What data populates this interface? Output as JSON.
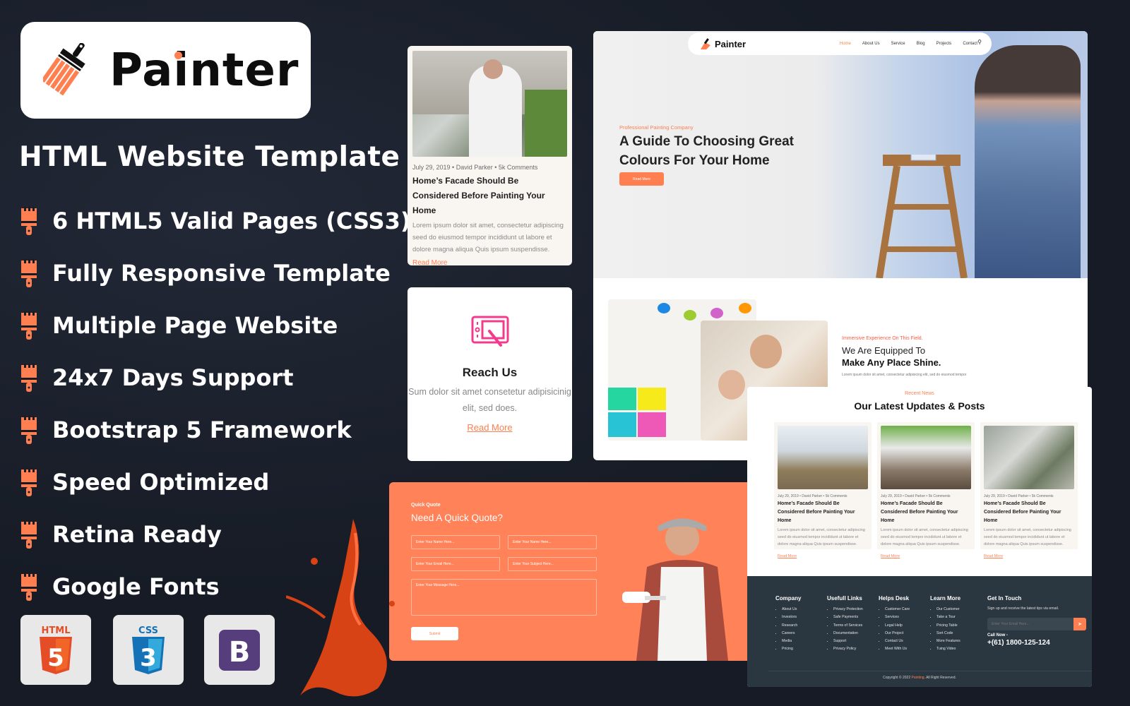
{
  "brand": {
    "name": "Painter",
    "accent": "#ff7f50"
  },
  "subtitle": "HTML Website Template",
  "features": [
    {
      "icon": "paint-brush-icon",
      "label": "6 HTML5 Valid Pages (CSS3)"
    },
    {
      "icon": "paint-brush-icon",
      "label": "Fully Responsive Template"
    },
    {
      "icon": "paint-brush-icon",
      "label": "Multiple Page Website"
    },
    {
      "icon": "paint-brush-icon",
      "label": "24x7 Days Support"
    },
    {
      "icon": "paint-brush-icon",
      "label": "Bootstrap 5 Framework"
    },
    {
      "icon": "paint-brush-icon",
      "label": "Speed Optimized"
    },
    {
      "icon": "paint-brush-icon",
      "label": "Retina Ready"
    },
    {
      "icon": "paint-brush-icon",
      "label": "Google Fonts"
    }
  ],
  "tech_badges": [
    {
      "icon": "html5-icon",
      "label": "HTML",
      "num": "5",
      "color": "#e44d26"
    },
    {
      "icon": "css3-icon",
      "label": "CSS",
      "num": "3",
      "color": "#1572b6"
    },
    {
      "icon": "bootstrap-icon",
      "label": "B",
      "color": "#563d7c"
    }
  ],
  "blog_card": {
    "meta": "July 29, 2019  •  David Parker  •  5k Comments",
    "title": "Home’s Facade Should Be Considered Before Painting Your Home",
    "excerpt": "Lorem ipsum dolor sit amet, consectetur adipiscing seed do eiusmod tempor incididunt ut labore et dolore magna aliqua Quis ipsum suspendisse.",
    "read_more": "Read More"
  },
  "reach_card": {
    "icon": "drawing-tablet-icon",
    "title": "Reach Us",
    "text": "Sum dolor sit amet consetetur adipisicinig elit, sed does.",
    "read_more": "Read More"
  },
  "site": {
    "nav": {
      "logo": "Painter",
      "links": [
        "Home",
        "About Us",
        "Service",
        "Blog",
        "Projects",
        "Contact"
      ],
      "active": "Home",
      "search_icon": "search-icon"
    },
    "hero": {
      "tag": "Professional Painting Company",
      "title_line1": "A Guide To Choosing Great",
      "title_line2": "Colours For Your Home",
      "button": "Read More"
    },
    "about": {
      "tag": "Immersive Experience On This Field.",
      "title_line1": "We Are Equipped To",
      "title_line2": "Make Any Place Shine.",
      "text": "Lorem ipsum dolor sit amet, consectetur adipisicing elit, sed do eiusmod tempor"
    }
  },
  "news": {
    "tag": "Recent News",
    "title": "Our Latest Updates & Posts",
    "posts": [
      {
        "meta": "July 29, 2019  •  David Parker  •  5k Comments",
        "title": "Home’s Facade Should Be Considered Before Painting Your Home",
        "excerpt": "Lorem ipsum dolor sit amet, consectetur adipiscing seed do eiusmod tempor incididunt ut labore et dolore magna aliqua Quis ipsum suspendisse.",
        "read_more": "Read More"
      },
      {
        "meta": "July 29, 2019  •  David Parker  •  5k Comments",
        "title": "Home’s Facade Should Be Considered Before Painting Your Home",
        "excerpt": "Lorem ipsum dolor sit amet, consectetur adipiscing seed do eiusmod tempor incididunt ut labore et dolore magna aliqua Quis ipsum suspendisse.",
        "read_more": "Read More"
      },
      {
        "meta": "July 29, 2019  •  David Parker  •  5k Comments",
        "title": "Home’s Facade Should Be Considered Before Painting Your Home",
        "excerpt": "Lorem ipsum dolor sit amet, consectetur adipiscing seed do eiusmod tempor incididunt ut labore et dolore magna aliqua Quis ipsum suspendisse.",
        "read_more": "Read More"
      }
    ]
  },
  "footer": {
    "columns": [
      {
        "title": "Company",
        "links": [
          "About Us",
          "Investors",
          "Research",
          "Careers",
          "Media",
          "Pricing"
        ]
      },
      {
        "title": "Usefull Links",
        "links": [
          "Privacy Protection",
          "Safe Payments",
          "Terms of Services",
          "Documentation",
          "Support",
          "Privacy Policy"
        ]
      },
      {
        "title": "Helps Desk",
        "links": [
          "Customer Care",
          "Services",
          "Legal Help",
          "Our Project",
          "Contact Us",
          "Meet With Us"
        ]
      },
      {
        "title": "Learn More",
        "links": [
          "Our Customer",
          "Take a Tour",
          "Pricing Table",
          "Sort Code",
          "More Features",
          "Tuing Video"
        ]
      }
    ],
    "touch": {
      "title": "Get In Touch",
      "text": "Sign up and receive the latest tips via email.",
      "email_placeholder": "Enter Your Email Here...",
      "send_icon": "send-icon",
      "call_label": "Call Now -",
      "phone": "+(61) 1800-125-124"
    },
    "copyright_prefix": "Copyright © 2022 ",
    "copyright_brand": "Painting",
    "copyright_suffix": ". All Right Reserved."
  },
  "quote": {
    "tag": "Quick Quote",
    "title": "Need A Quick Quote?",
    "name_placeholder": "Enter Your Name Here...",
    "name2_placeholder": "Enter Your Name Here...",
    "email_placeholder": "Enter Your Email Here...",
    "subject_placeholder": "Enter Your Subject Here...",
    "message_placeholder": "Enter Your Message Here...",
    "submit": "Submit"
  }
}
